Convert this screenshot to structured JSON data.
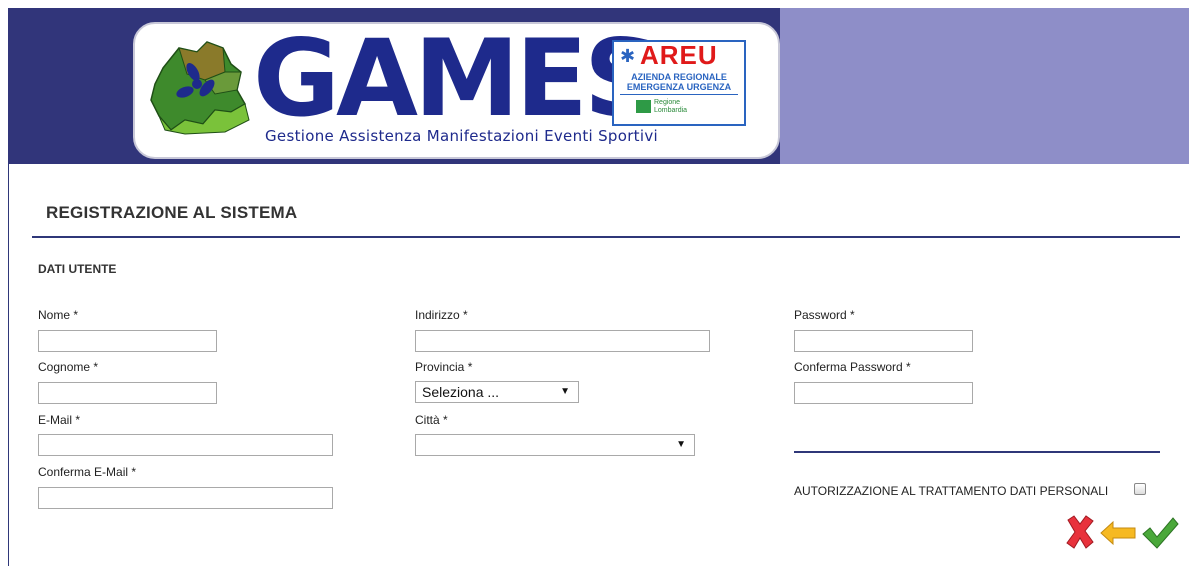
{
  "header": {
    "logo_title": "GAMES",
    "logo_tagline": "Gestione Assistenza Manifestazioni Eventi Sportivi",
    "areu_title": "AREU",
    "areu_line1": "AZIENDA REGIONALE",
    "areu_line2": "EMERGENZA URGENZA",
    "region_line1": "Regione",
    "region_line2": "Lombardia",
    "colors": {
      "dark": "#31357a",
      "light": "#8e8ec8"
    }
  },
  "page_title": "REGISTRAZIONE AL SISTEMA",
  "section_title": "DATI UTENTE",
  "form": {
    "nome_label": "Nome *",
    "cognome_label": "Cognome *",
    "email_label": "E-Mail *",
    "conferma_email_label": "Conferma E-Mail *",
    "indirizzo_label": "Indirizzo *",
    "provincia_label": "Provincia *",
    "provincia_value": "Seleziona ...",
    "citta_label": "Città *",
    "citta_value": "",
    "password_label": "Password *",
    "conferma_password_label": "Conferma Password *",
    "nome": "",
    "cognome": "",
    "email": "",
    "conferma_email": "",
    "indirizzo": "",
    "password": "",
    "conferma_password": ""
  },
  "authorization_label": "AUTORIZZAZIONE AL TRATTAMENTO DATI PERSONALI",
  "actions": {
    "cancel_icon": "cancel-x-icon",
    "back_icon": "back-arrow-icon",
    "confirm_icon": "confirm-check-icon"
  }
}
